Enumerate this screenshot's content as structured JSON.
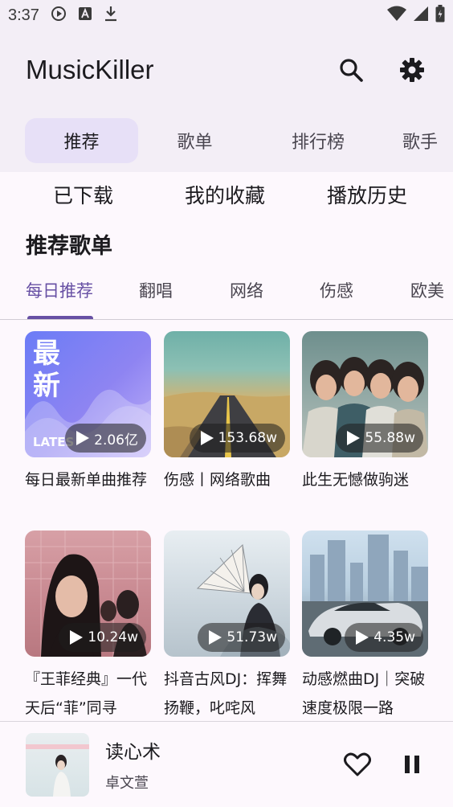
{
  "status": {
    "time": "3:37",
    "icons": [
      "play-circle-icon",
      "text-a-icon",
      "download-icon",
      "wifi-icon",
      "signal-icon",
      "battery-icon"
    ]
  },
  "app": {
    "title": "MusicKiller",
    "actions": [
      "search-icon",
      "settings-icon"
    ]
  },
  "top_tabs": [
    {
      "label": "推荐",
      "active": true
    },
    {
      "label": "歌单",
      "active": false
    },
    {
      "label": "排行榜",
      "active": false
    },
    {
      "label": "歌手",
      "active": false
    }
  ],
  "quick_links": [
    "已下载",
    "我的收藏",
    "播放历史"
  ],
  "section": {
    "title": "推荐歌单"
  },
  "categories": [
    {
      "label": "每日推荐",
      "active": true
    },
    {
      "label": "翻唱",
      "active": false
    },
    {
      "label": "网络",
      "active": false
    },
    {
      "label": "伤感",
      "active": false
    },
    {
      "label": "欧美",
      "active": false
    }
  ],
  "playlists": [
    {
      "title": "每日最新单曲推荐",
      "plays": "2.06亿",
      "cover_text": [
        "最",
        "新",
        "LATES"
      ]
    },
    {
      "title": "伤感丨网络歌曲",
      "plays": "153.68w"
    },
    {
      "title": "此生无憾做驹迷",
      "plays": "55.88w"
    },
    {
      "title": "『王菲经典』一代天后“菲”同寻",
      "plays": "10.24w"
    },
    {
      "title": "抖音古风DJ：挥舞扬鞭，叱咤风",
      "plays": "51.73w"
    },
    {
      "title": "动感燃曲DJ｜突破速度极限一路",
      "plays": "4.35w"
    }
  ],
  "player": {
    "title": "读心术",
    "artist": "卓文萱",
    "actions": [
      "heart-icon",
      "pause-icon"
    ]
  },
  "colors": {
    "accent": "#6750a4",
    "surface": "#f3eef6",
    "active_tab_bg": "#e7e0f7",
    "background": "#fdf8fd"
  }
}
